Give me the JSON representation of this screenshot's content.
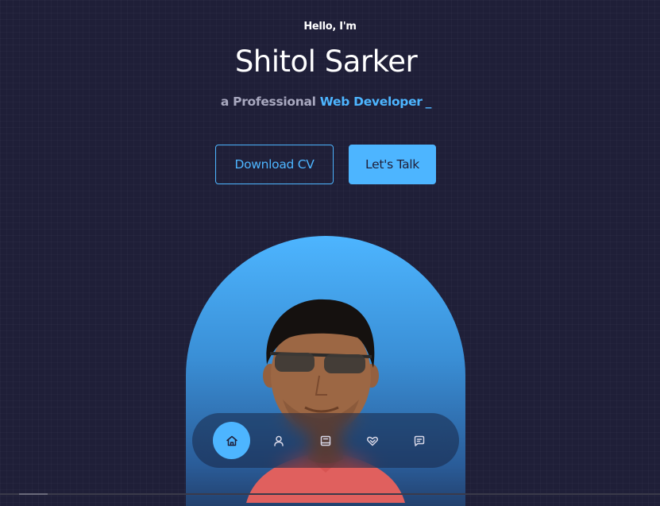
{
  "hero": {
    "greeting": "Hello, I'm",
    "name": "Shitol Sarker",
    "subtitle_prefix": "a Professional",
    "role": "Web Developer",
    "cursor": "_"
  },
  "actions": {
    "download_cv_label": "Download CV",
    "lets_talk_label": "Let's Talk"
  },
  "nav": {
    "items": [
      {
        "icon": "home-icon",
        "active": true
      },
      {
        "icon": "user-icon",
        "active": false
      },
      {
        "icon": "book-icon",
        "active": false
      },
      {
        "icon": "handshake-icon",
        "active": false
      },
      {
        "icon": "message-icon",
        "active": false
      }
    ]
  },
  "colors": {
    "background": "#1f1f38",
    "accent": "#4db5ff",
    "text_light": "#ffffff",
    "text_muted": "#a9a9c0"
  }
}
